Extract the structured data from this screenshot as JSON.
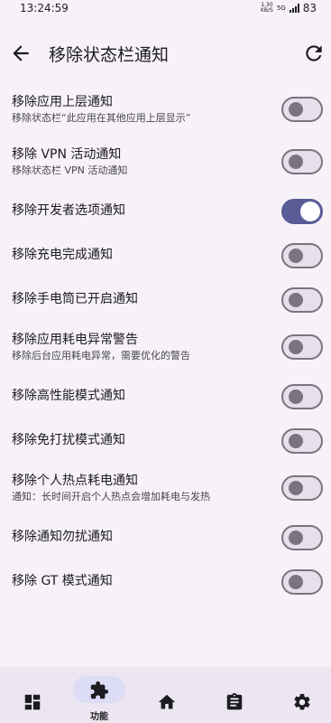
{
  "status_bar": {
    "time": "13:24:59",
    "net_speed_value": "1.30",
    "net_speed_unit": "KB/S",
    "network_type": "5G",
    "battery": "83"
  },
  "header": {
    "title": "移除状态栏通知",
    "back_icon": "arrow-left-icon",
    "refresh_icon": "refresh-icon"
  },
  "settings": [
    {
      "title": "移除应用上层通知",
      "subtitle": "移除状态栏“此应用在其他应用上层显示”",
      "enabled": false
    },
    {
      "title": "移除 VPN 活动通知",
      "subtitle": "移除状态栏 VPN 活动通知",
      "enabled": false
    },
    {
      "title": "移除开发者选项通知",
      "subtitle": "",
      "enabled": true
    },
    {
      "title": "移除充电完成通知",
      "subtitle": "",
      "enabled": false
    },
    {
      "title": "移除手电筒已开启通知",
      "subtitle": "",
      "enabled": false
    },
    {
      "title": "移除应用耗电异常警告",
      "subtitle": "移除后台应用耗电异常，需要优化的警告",
      "enabled": false
    },
    {
      "title": "移除高性能模式通知",
      "subtitle": "",
      "enabled": false
    },
    {
      "title": "移除免打扰模式通知",
      "subtitle": "",
      "enabled": false
    },
    {
      "title": "移除个人热点耗电通知",
      "subtitle": "通知：长时间开启个人热点会增加耗电与发热",
      "enabled": false
    },
    {
      "title": "移除通知勿扰通知",
      "subtitle": "",
      "enabled": false
    },
    {
      "title": "移除 GT 模式通知",
      "subtitle": "",
      "enabled": false
    }
  ],
  "bottom_nav": {
    "items": [
      {
        "icon": "dashboard-icon",
        "label": ""
      },
      {
        "icon": "puzzle-icon",
        "label": "功能",
        "active": true
      },
      {
        "icon": "home-icon",
        "label": ""
      },
      {
        "icon": "clipboard-icon",
        "label": ""
      },
      {
        "icon": "gear-icon",
        "label": ""
      }
    ]
  },
  "colors": {
    "background": "#f6f2f8",
    "switch_on": "#5a5c98",
    "switch_off_track": "#e7e0ec",
    "nav_background": "#ebe6f1",
    "nav_active_pill": "#dcdcf7"
  }
}
